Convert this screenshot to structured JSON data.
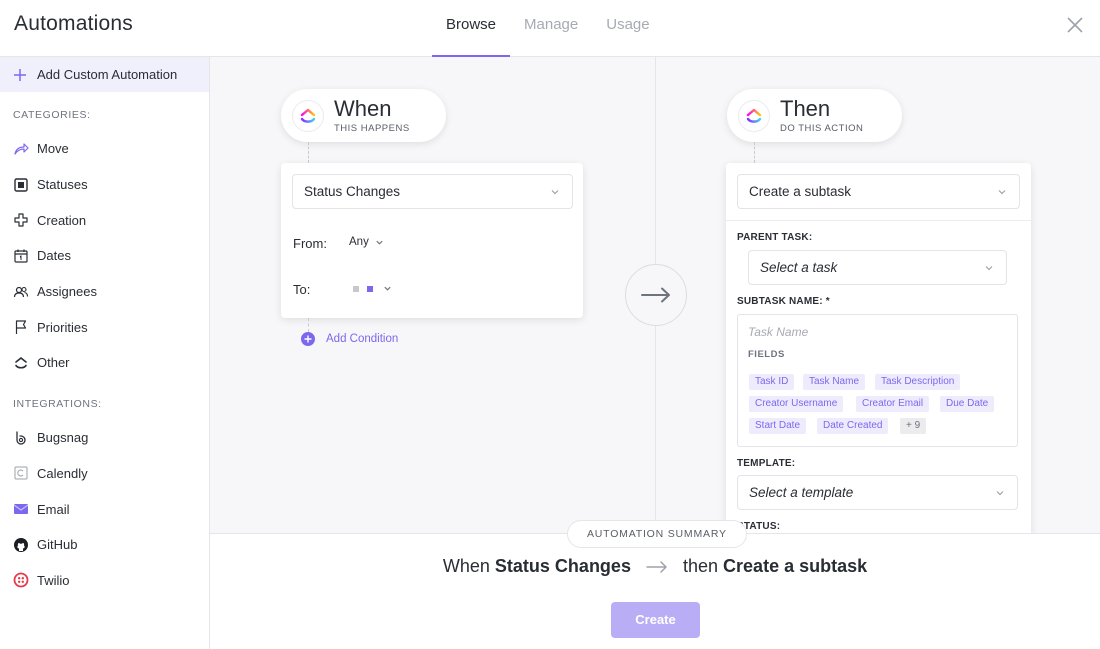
{
  "header": {
    "title": "Automations",
    "tabs": [
      {
        "label": "Browse",
        "active": true
      },
      {
        "label": "Manage",
        "active": false
      },
      {
        "label": "Usage",
        "active": false
      }
    ]
  },
  "sidebar": {
    "add_custom_label": "Add Custom Automation",
    "categories_label": "CATEGORIES:",
    "categories": [
      {
        "label": "Move",
        "icon": "move-icon"
      },
      {
        "label": "Statuses",
        "icon": "statuses-icon"
      },
      {
        "label": "Creation",
        "icon": "creation-icon"
      },
      {
        "label": "Dates",
        "icon": "calendar-icon"
      },
      {
        "label": "Assignees",
        "icon": "assignees-icon"
      },
      {
        "label": "Priorities",
        "icon": "flag-icon"
      },
      {
        "label": "Other",
        "icon": "clickup-icon"
      }
    ],
    "integrations_label": "INTEGRATIONS:",
    "integrations": [
      {
        "label": "Bugsnag",
        "icon": "bugsnag-icon"
      },
      {
        "label": "Calendly",
        "icon": "calendly-icon"
      },
      {
        "label": "Email",
        "icon": "email-icon"
      },
      {
        "label": "GitHub",
        "icon": "github-icon"
      },
      {
        "label": "Twilio",
        "icon": "twilio-icon"
      }
    ]
  },
  "trigger": {
    "title": "When",
    "subtitle": "THIS HAPPENS",
    "select_value": "Status Changes",
    "from_label": "From:",
    "from_value": "Any",
    "to_label": "To:",
    "add_condition_label": "Add Condition"
  },
  "action": {
    "title": "Then",
    "subtitle": "DO THIS ACTION",
    "select_value": "Create a subtask",
    "parent_task_label": "PARENT TASK:",
    "parent_task_placeholder": "Select a task",
    "subtask_name_label": "SUBTASK NAME: *",
    "task_name_placeholder": "Task Name",
    "fields_label": "FIELDS",
    "fields": [
      "Task ID",
      "Task Name",
      "Task Description",
      "Creator Username",
      "Creator Email",
      "Due Date",
      "Start Date",
      "Date Created"
    ],
    "fields_more": "+ 9",
    "template_label": "TEMPLATE:",
    "template_placeholder": "Select a template",
    "status_label": "STATUS:"
  },
  "summary": {
    "badge": "AUTOMATION SUMMARY",
    "when_word": "When",
    "trigger_text": "Status Changes",
    "then_word": "then",
    "action_text": "Create a subtask",
    "create_label": "Create"
  },
  "colors": {
    "accent": "#7b68ee",
    "accent_light": "#eeecfc",
    "create_disabled": "#b9aef5"
  }
}
